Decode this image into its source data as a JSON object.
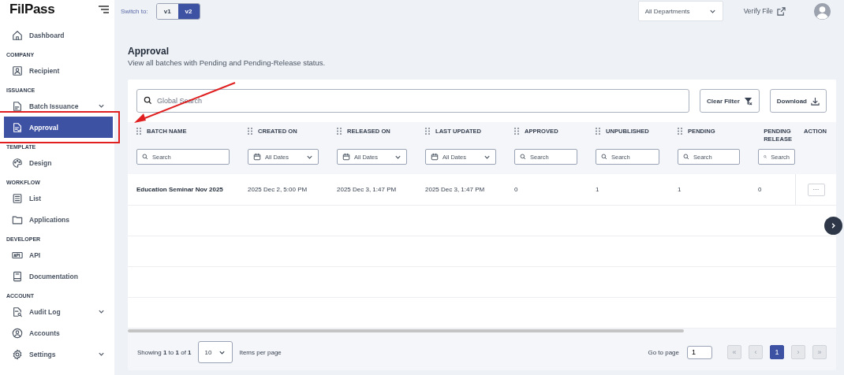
{
  "logo": "FilPass",
  "sidebar": {
    "sections": [
      {
        "items": [
          {
            "label": "Dashboard",
            "selected": false,
            "has_submenu": false
          }
        ]
      },
      {
        "label": "COMPANY",
        "items": [
          {
            "label": "Recipient",
            "selected": false,
            "has_submenu": false
          }
        ]
      },
      {
        "label": "ISSUANCE",
        "items": [
          {
            "label": "Batch Issuance",
            "selected": false,
            "has_submenu": true
          },
          {
            "label": "Approval",
            "selected": true,
            "has_submenu": false
          }
        ]
      },
      {
        "label": "TEMPLATE",
        "items": [
          {
            "label": "Design",
            "selected": false,
            "has_submenu": false
          }
        ]
      },
      {
        "label": "WORKFLOW",
        "items": [
          {
            "label": "List",
            "selected": false,
            "has_submenu": false
          },
          {
            "label": "Applications",
            "selected": false,
            "has_submenu": false
          }
        ]
      },
      {
        "label": "DEVELOPER",
        "items": [
          {
            "label": "API",
            "selected": false,
            "has_submenu": false
          },
          {
            "label": "Documentation",
            "selected": false,
            "has_submenu": false
          }
        ]
      },
      {
        "label": "ACCOUNT",
        "items": [
          {
            "label": "Audit Log",
            "selected": false,
            "has_submenu": true
          },
          {
            "label": "Accounts",
            "selected": false,
            "has_submenu": false
          },
          {
            "label": "Settings",
            "selected": false,
            "has_submenu": true
          }
        ]
      }
    ]
  },
  "topbar": {
    "switch_label": "Switch to:",
    "versions": [
      {
        "label": "v1",
        "selected": false
      },
      {
        "label": "v2",
        "selected": true
      }
    ],
    "department": "All Departments",
    "verify": "Verify File"
  },
  "page": {
    "title": "Approval",
    "subtitle": "View all batches with Pending and Pending-Release status."
  },
  "toolbar": {
    "search_placeholder": "Global Search",
    "clear": "Clear Filter",
    "download": "Download"
  },
  "table": {
    "columns": [
      {
        "label": "BATCH NAME",
        "kind": "search",
        "filter": "Search"
      },
      {
        "label": "CREATED ON",
        "kind": "date",
        "filter": "All Dates"
      },
      {
        "label": "RELEASED ON",
        "kind": "date",
        "filter": "All Dates"
      },
      {
        "label": "LAST UPDATED",
        "kind": "date",
        "filter": "All Dates"
      },
      {
        "label": "APPROVED",
        "kind": "search",
        "filter": "Search"
      },
      {
        "label": "UNPUBLISHED",
        "kind": "search",
        "filter": "Search"
      },
      {
        "label": "PENDING",
        "kind": "search",
        "filter": "Search"
      },
      {
        "label": "PENDING RELEASE",
        "kind": "search",
        "filter": "Search"
      }
    ],
    "action_label": "ACTION",
    "rows": [
      {
        "cells": [
          "Education Seminar Nov 2025",
          "2025 Dec 2, 5:00 PM",
          "2025 Dec 3, 1:47 PM",
          "2025 Dec 3, 1:47 PM",
          "0",
          "1",
          "1",
          "0"
        ],
        "action": "···"
      }
    ]
  },
  "footer": {
    "showing": "Showing **1** to **1** of **1**",
    "per_page": "10",
    "per_page_label": "Items per page",
    "goto_label": "Go to page",
    "goto_value": "1",
    "pages": [
      {
        "label": "«",
        "selected": false
      },
      {
        "label": "‹",
        "selected": false
      },
      {
        "label": "1",
        "selected": true
      },
      {
        "label": "›",
        "selected": false
      },
      {
        "label": "»",
        "selected": false
      }
    ]
  }
}
